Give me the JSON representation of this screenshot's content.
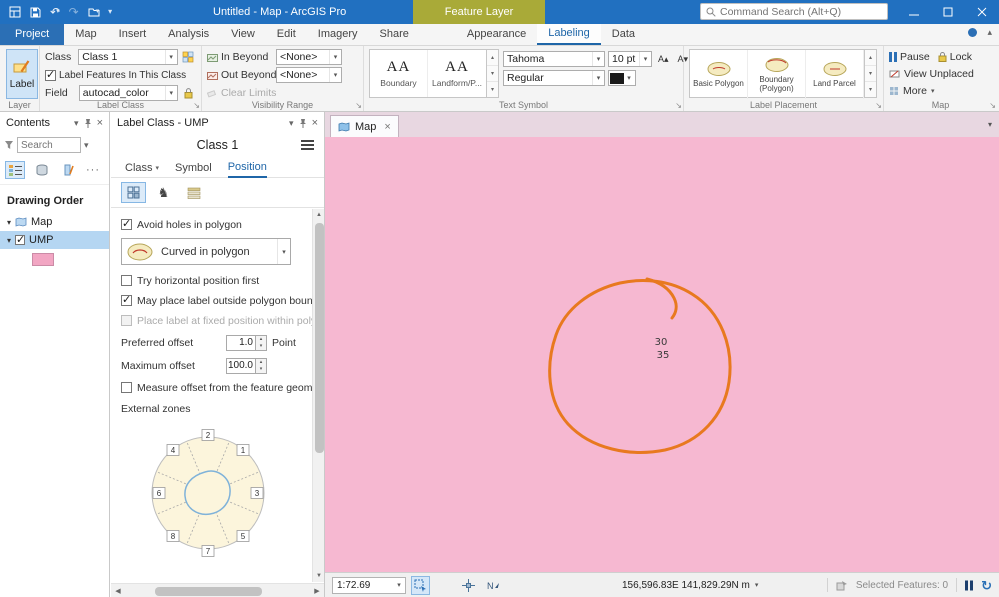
{
  "titlebar": {
    "title": "Untitled - Map - ArcGIS Pro",
    "contextual_header": "Feature Layer",
    "help_label": "?"
  },
  "tabs": {
    "main": [
      "Project",
      "Map",
      "Insert",
      "Analysis",
      "View",
      "Edit",
      "Imagery",
      "Share"
    ],
    "contextual": [
      "Appearance",
      "Labeling",
      "Data"
    ],
    "search_placeholder": "Command Search (Alt+Q)"
  },
  "ribbon": {
    "layer_group": {
      "label": "Layer",
      "button": "Label"
    },
    "label_class_group": {
      "label": "Label Class",
      "class_label": "Class",
      "class_value": "Class 1",
      "features_checkbox": "Label Features In This Class",
      "field_label": "Field",
      "field_value": "autocad_color"
    },
    "visibility_group": {
      "label": "Visibility Range",
      "in_beyond": "In Beyond",
      "out_beyond": "Out Beyond",
      "in_value": "<None>",
      "out_value": "<None>",
      "clear_limits": "Clear Limits"
    },
    "text_symbol_group": {
      "label": "Text Symbol",
      "gallery": [
        {
          "glyph": "AA",
          "name": "Boundary"
        },
        {
          "glyph": "AA",
          "name": "Landform/P..."
        }
      ],
      "font": "Tahoma",
      "size": "10 pt",
      "style": "Regular"
    },
    "placement_group": {
      "label": "Label Placement",
      "items": [
        "Basic Polygon",
        "Boundary (Polygon)",
        "Land Parcel"
      ]
    },
    "map_group": {
      "label": "Map",
      "pause": "Pause",
      "lock": "Lock",
      "view_unplaced": "View Unplaced",
      "more": "More"
    }
  },
  "contents_pane": {
    "title": "Contents",
    "search_placeholder": "Search",
    "section_title": "Drawing Order",
    "map_item": "Map",
    "layer_item": "UMP"
  },
  "label_class_pane": {
    "title": "Label Class - UMP",
    "heading": "Class 1",
    "tab_class": "Class",
    "tab_symbol": "Symbol",
    "tab_position": "Position",
    "avoid_holes": "Avoid holes in polygon",
    "placement_style": "Curved in polygon",
    "try_horizontal": "Try horizontal position first",
    "may_place_outside": "May place label outside polygon bounda",
    "fixed_position": "Place label at fixed position within polygo",
    "preferred_offset_label": "Preferred offset",
    "preferred_offset_value": "1.0",
    "preferred_offset_unit": "Point",
    "maximum_offset_label": "Maximum offset",
    "maximum_offset_value": "100.0",
    "measure_offset": "Measure offset from the feature geometr",
    "external_zones": "External zones",
    "zone_numbers": [
      "2",
      "1",
      "3",
      "5",
      "7",
      "8",
      "6",
      "4"
    ]
  },
  "map_view": {
    "tab_label": "Map",
    "feature_labels": [
      "30",
      "35"
    ],
    "status": {
      "scale": "1:72.69",
      "coordinates": "156,596.83E 141,829.29N m",
      "selected_features": "Selected Features: 0"
    }
  },
  "colors": {
    "titlebar_blue": "#2170c0",
    "contextual_olive": "#a9aa38",
    "accent_blue": "#2b6fb5",
    "map_pink": "#f6b8d1",
    "scribble_orange": "#e8791f",
    "layer_swatch_pink": "#f2a6c3"
  }
}
